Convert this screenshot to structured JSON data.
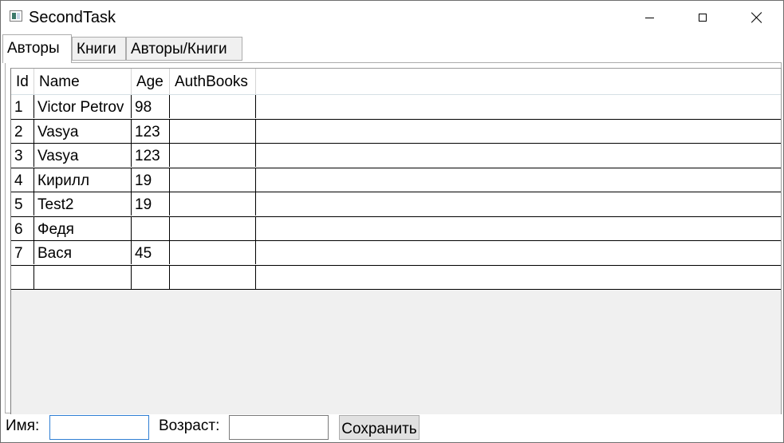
{
  "window": {
    "title": "SecondTask"
  },
  "tabs": [
    {
      "label": "Авторы",
      "active": true
    },
    {
      "label": "Книги",
      "active": false
    },
    {
      "label": "Авторы/Книги",
      "active": false
    }
  ],
  "grid": {
    "columns": [
      "Id",
      "Name",
      "Age",
      "AuthBooks"
    ],
    "rows": [
      [
        "1",
        "Victor Petrov",
        "98",
        ""
      ],
      [
        "2",
        "Vasya",
        "123",
        ""
      ],
      [
        "3",
        "Vasya",
        "123",
        ""
      ],
      [
        "4",
        "Кирилл",
        "19",
        ""
      ],
      [
        "5",
        "Test2",
        "19",
        ""
      ],
      [
        "6",
        "Федя",
        "",
        ""
      ],
      [
        "7",
        "Вася",
        "45",
        ""
      ],
      [
        "",
        "",
        "",
        ""
      ]
    ]
  },
  "form": {
    "name_label": "Имя:",
    "name_value": "",
    "age_label": "Возраст:",
    "age_value": "",
    "save_label": "Сохранить"
  },
  "colors": {
    "focus_border": "#2f7fd4",
    "grid_background": "#f0f0f0"
  }
}
